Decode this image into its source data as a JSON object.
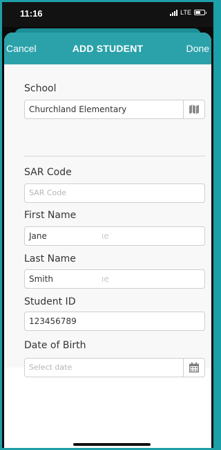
{
  "status_bar": {
    "time": "11:16",
    "network": "LTE",
    "signal_icon": "signal-bars-icon",
    "battery_icon": "battery-icon"
  },
  "nav": {
    "cancel_label": "Cancel",
    "title": "ADD STUDENT",
    "done_label": "Done"
  },
  "form": {
    "school": {
      "label": "School",
      "value": "Churchland Elementary",
      "icon": "map-icon"
    },
    "sar_code": {
      "label": "SAR Code",
      "placeholder": "SAR Code"
    },
    "first_name": {
      "label": "First Name",
      "value": "Jane",
      "ghost_text": "ıe"
    },
    "last_name": {
      "label": "Last Name",
      "value": "Smith",
      "ghost_text": "ıe"
    },
    "student_id": {
      "label": "Student ID",
      "value": "123456789"
    },
    "date_of_birth": {
      "label": "Date of Birth",
      "placeholder": "Select date",
      "icon": "calendar-icon"
    }
  },
  "colors": {
    "accent": "#2ba2aa",
    "frame": "#1e9ea6",
    "form_background": "#f8f8f8"
  }
}
